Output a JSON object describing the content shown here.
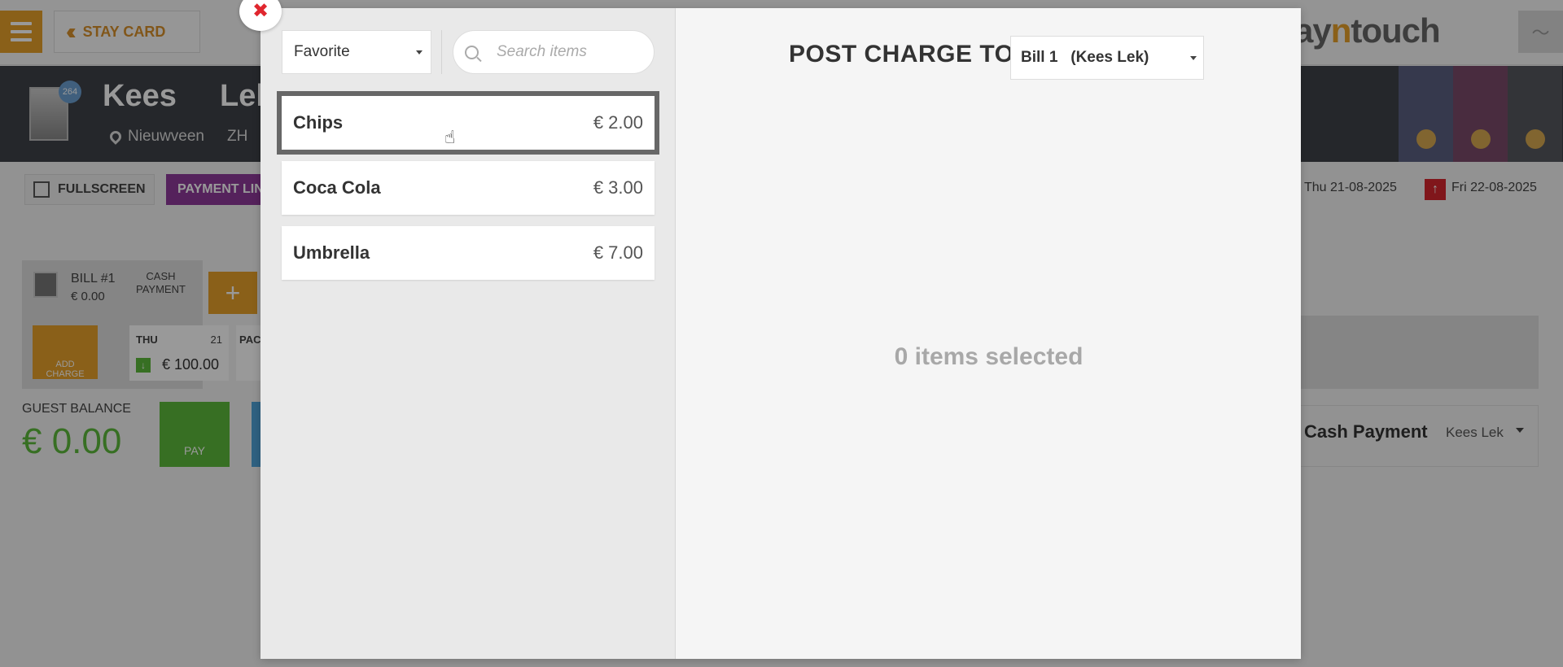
{
  "app": {
    "nav_title": "STAY CARD",
    "brand_prefix": "ay",
    "brand_accent": "n",
    "brand_suffix": "touch"
  },
  "guest": {
    "first_name": "Kees",
    "last_name": "Lek",
    "city": "Nieuwveen",
    "state": "ZH",
    "badge_count": "264"
  },
  "toolbar": {
    "fullscreen_label": "FULLSCREEN",
    "payment_link_label": "PAYMENT LINK",
    "arrival_date": "Thu 21-08-2025",
    "departure_date": "Fri 22-08-2025"
  },
  "bill": {
    "name": "BILL #1",
    "amount": "€ 0.00",
    "method_line1": "CASH",
    "method_line2": "PAYMENT",
    "add_label": "+",
    "add_charge_line1": "ADD",
    "add_charge_line2": "CHARGE",
    "day_name": "THU",
    "day_number": "21",
    "day_amount": "€ 100.00",
    "day2_name": "PAC"
  },
  "balance": {
    "label": "GUEST BALANCE",
    "value": "€ 0.00",
    "pay_label": "PAY",
    "payment_method": "Cash Payment",
    "payer": "Kees Lek"
  },
  "modal": {
    "close_symbol": "✖",
    "category": "Favorite",
    "search_placeholder": "Search items",
    "items": [
      {
        "name": "Chips",
        "price": "€ 2.00"
      },
      {
        "name": "Coca Cola",
        "price": "€ 3.00"
      },
      {
        "name": "Umbrella",
        "price": "€ 7.00"
      }
    ],
    "post_charge_label": "POST CHARGE TO",
    "bill_selection": "Bill 1   (Kees Lek)",
    "empty_message": "0 items selected"
  },
  "colors": {
    "accent": "#e6a02a",
    "payment_link": "#8e3a9a",
    "balance_green": "#5dba3b",
    "close_red": "#e0262e",
    "departure_red": "#d6262e"
  }
}
